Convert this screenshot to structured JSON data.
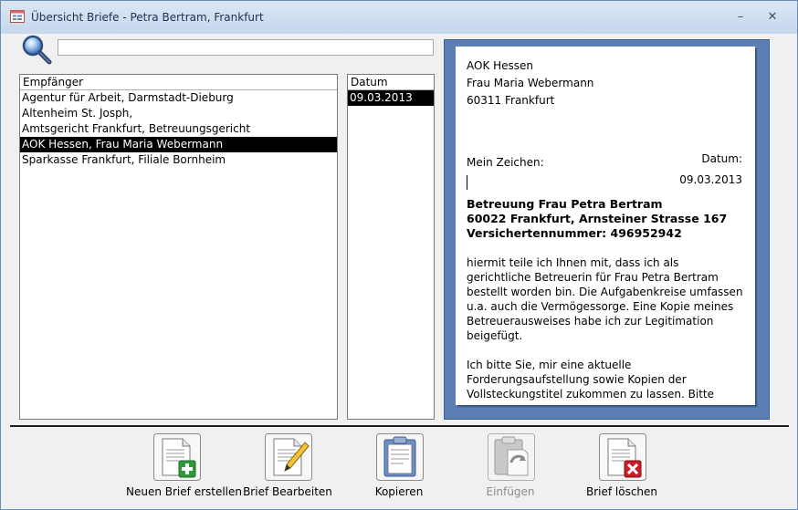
{
  "window": {
    "title": "Übersicht Briefe - Petra Bertram, Frankfurt",
    "min_symbol": "–",
    "close_symbol": "✕"
  },
  "search": {
    "value": "",
    "icon": "magnifier-icon"
  },
  "recipients": {
    "header": "Empfänger",
    "rows": [
      "Agentur für Arbeit, Darmstadt-Dieburg",
      "Altenheim St. Josph,",
      "Amtsgericht Frankfurt, Betreuungsgericht",
      "AOK Hessen, Frau Maria Webermann",
      "Sparkasse Frankfurt, Filiale Bornheim"
    ],
    "selected_index": 3
  },
  "dates": {
    "header": "Datum",
    "rows": [
      "09.03.2013"
    ],
    "selected_index": 0
  },
  "letter": {
    "address_line1": "AOK Hessen",
    "address_line2": "Frau Maria Webermann",
    "address_line3": "60311 Frankfurt",
    "my_ref_label": "Mein Zeichen:",
    "date_label": "Datum:",
    "date_value": "09.03.2013",
    "subject_line1": "Betreuung Frau Petra Bertram",
    "subject_line2": "60022 Frankfurt, Arnsteiner Strasse 167",
    "subject_line3": "Versichertennummer: 496952942",
    "paragraph1": "hiermit teile ich Ihnen mit, dass ich als gerichtliche Betreuerin für Frau Petra Bertram bestellt worden bin. Die Aufgabenkreise umfassen u.a. auch die Vermögessorge. Eine Kopie meines Betreuerausweises habe ich zur Legitimation beigefügt.",
    "paragraph2": "Ich bitte Sie, mir eine aktuelle Forderungsaufstellung sowie Kopien der Vollsteckungstitel zukommen zu lassen. Bitte"
  },
  "actions": {
    "new_letter": {
      "label": "Neuen Brief erstellen",
      "icon": "new-document-icon",
      "enabled": true
    },
    "edit_letter": {
      "label": "Brief Bearbeiten",
      "icon": "edit-document-icon",
      "enabled": true
    },
    "copy": {
      "label": "Kopieren",
      "icon": "clipboard-icon",
      "enabled": true
    },
    "paste": {
      "label": "Einfügen",
      "icon": "paste-icon",
      "enabled": false
    },
    "delete_letter": {
      "label": "Brief löschen",
      "icon": "delete-document-icon",
      "enabled": true
    }
  },
  "colors": {
    "preview_background": "#5b7fb4",
    "selection": "#000000",
    "add_green": "#2e9b3a",
    "delete_red": "#c8202a"
  }
}
